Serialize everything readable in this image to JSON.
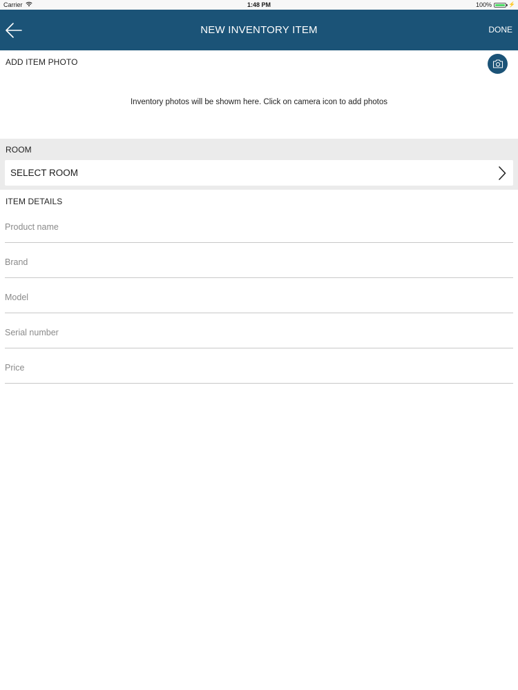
{
  "status_bar": {
    "carrier": "Carrier",
    "time": "1:48 PM",
    "battery": "100%",
    "battery_level": 1.0,
    "wifi_icon": "wifi-icon",
    "battery_icon": "battery-icon"
  },
  "navbar": {
    "title": "NEW INVENTORY ITEM",
    "done_label": "DONE",
    "back_icon": "back-arrow-icon",
    "background_color": "#1b5377"
  },
  "photo": {
    "section_label": "ADD ITEM PHOTO",
    "hint": "Inventory photos will be showm here. Click on camera icon to add photos",
    "camera_icon": "camera-icon"
  },
  "room": {
    "section_label": "ROOM",
    "select_label": "SELECT ROOM",
    "chevron_icon": "chevron-right-icon"
  },
  "item_details": {
    "section_label": "ITEM DETAILS",
    "fields": [
      {
        "placeholder": "Product name",
        "value": ""
      },
      {
        "placeholder": "Brand",
        "value": ""
      },
      {
        "placeholder": "Model",
        "value": ""
      },
      {
        "placeholder": "Serial number",
        "value": ""
      },
      {
        "placeholder": "Price",
        "value": ""
      }
    ]
  }
}
